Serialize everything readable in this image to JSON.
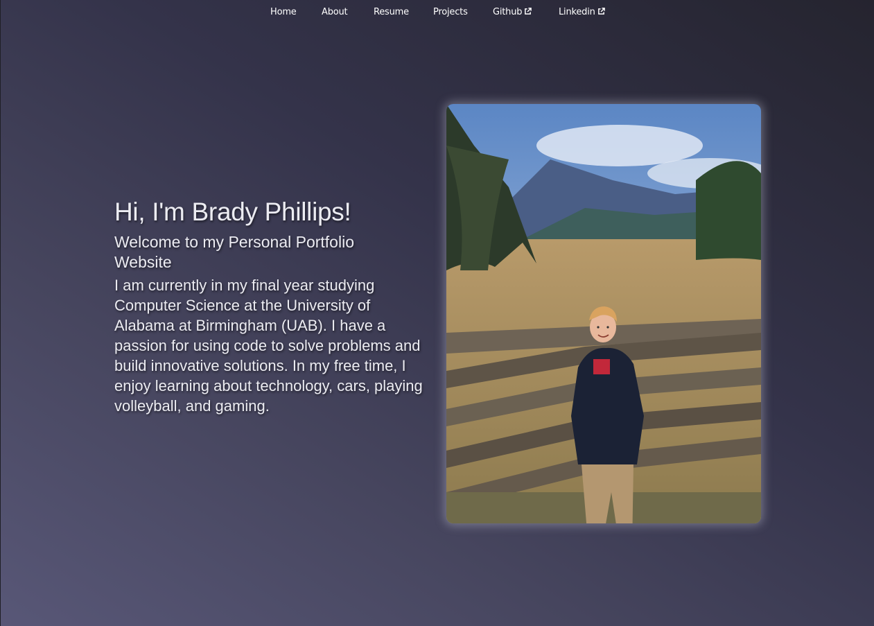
{
  "nav": {
    "items": [
      {
        "label": "Home",
        "external": false
      },
      {
        "label": "About",
        "external": false
      },
      {
        "label": "Resume",
        "external": false
      },
      {
        "label": "Projects",
        "external": false
      },
      {
        "label": "Github",
        "external": true,
        "icon": "external-link-icon"
      },
      {
        "label": "Linkedin",
        "external": true,
        "icon": "external-link-icon"
      }
    ]
  },
  "hero": {
    "heading": "Hi, I'm Brady Phillips!",
    "subheading": "Welcome to my Personal Portfolio Website",
    "bio": "I am currently in my final year studying Computer Science at the University of Alabama at Birmingham (UAB). I have a passion for using code to solve problems and build innovative solutions. In my free time, I enjoy learning about technology, cars, playing volleyball, and gaming."
  },
  "photo": {
    "subject": "portrait-photo"
  },
  "colors": {
    "background_dark": "#25242f",
    "background_light": "#585777",
    "text": "#ececf2",
    "nav_text": "#ffffff"
  }
}
